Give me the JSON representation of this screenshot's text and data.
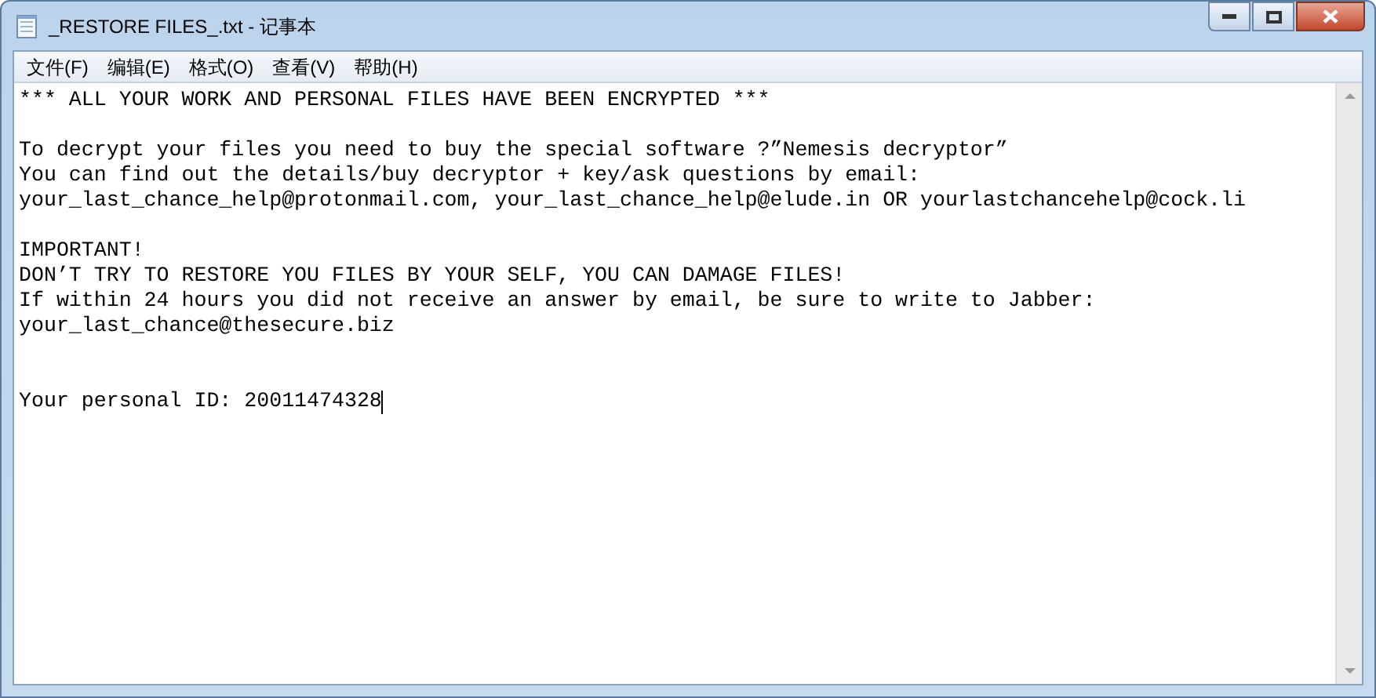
{
  "window": {
    "title": "_RESTORE FILES_.txt - 记事本"
  },
  "caret": true,
  "menu": [
    "文件(F)",
    "编辑(E)",
    "格式(O)",
    "查看(V)",
    "帮助(H)"
  ],
  "document": {
    "blocks": [
      {
        "kind": "paragraph",
        "lines": [
          "*** ALL YOUR WORK AND PERSONAL FILES HAVE BEEN ENCRYPTED ***"
        ]
      },
      {
        "kind": "paragraph",
        "lines": [
          "To decrypt your files you need to buy the special software ?”Nemesis decryptor”",
          "You can find out the details/buy decryptor + key/ask questions by email:",
          "your_last_chance_help@protonmail.com, your_last_chance_help@elude.in OR yourlastchancehelp@cock.li"
        ]
      },
      {
        "kind": "paragraph",
        "lines": [
          "IMPORTANT!",
          "DON’T TRY TO RESTORE YOU FILES BY YOUR SELF, YOU CAN DAMAGE FILES!",
          "If within 24 hours you did not receive an answer by email, be sure to write to Jabber:",
          "your_last_chance@thesecure.biz"
        ]
      },
      {
        "kind": "footer",
        "lines": [
          "Your personal ID: 20011474328"
        ]
      }
    ]
  }
}
